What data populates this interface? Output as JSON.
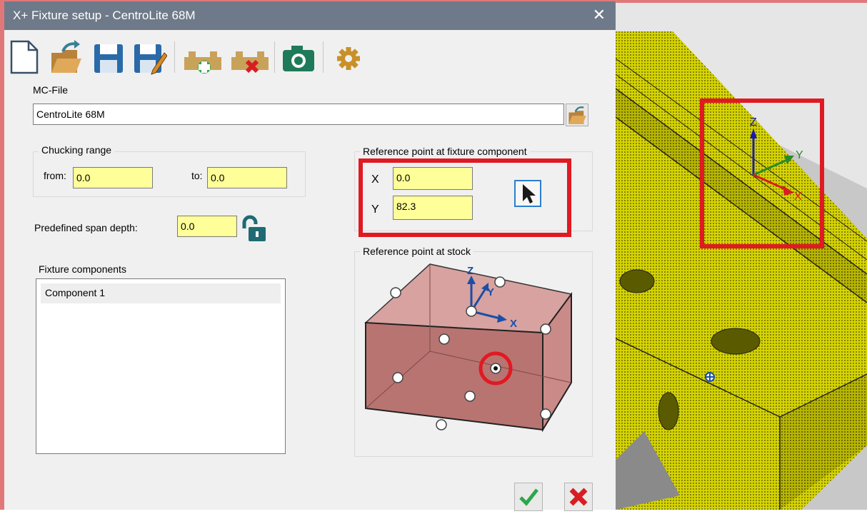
{
  "dialog": {
    "title": "X+ Fixture setup - CentroLite 68M",
    "close_glyph": "✕"
  },
  "toolbar": {
    "buttons": [
      {
        "name": "new-file-icon"
      },
      {
        "name": "open-folder-icon"
      },
      {
        "name": "save-icon"
      },
      {
        "name": "save-as-icon"
      },
      {
        "name": "add-component-icon"
      },
      {
        "name": "remove-component-icon"
      },
      {
        "name": "camera-icon"
      },
      {
        "name": "settings-gear-icon"
      }
    ]
  },
  "mc_file": {
    "label": "MC-File",
    "value": "CentroLite 68M"
  },
  "chucking": {
    "caption": "Chucking range",
    "from_label": "from:",
    "from_value": "0.0",
    "to_label": "to:",
    "to_value": "0.0"
  },
  "span": {
    "label": "Predefined span depth:",
    "value": "0.0"
  },
  "ref_fixture": {
    "caption": "Reference point at fixture component",
    "x_label": "X",
    "x_value": "0.0",
    "y_label": "Y",
    "y_value": "82.3"
  },
  "ref_stock": {
    "caption": "Reference point at stock",
    "axis_z": "Z",
    "axis_y": "Y",
    "axis_x": "X"
  },
  "components": {
    "label": "Fixture components",
    "items": [
      "Component 1"
    ]
  },
  "view3d": {
    "axis_z": "Z",
    "axis_y": "Y",
    "axis_x": "X"
  },
  "colors": {
    "titlebar": "#6e7a89",
    "field_yellow": "#ffff99",
    "highlight_red": "#e01a22",
    "model_yellow": "#d6d400",
    "stock_pink": "#c98a8a"
  }
}
